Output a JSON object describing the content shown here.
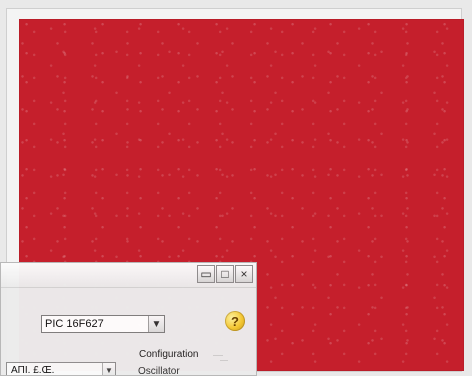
{
  "image_panel": {
    "background_color": "#c51f2c"
  },
  "dialog": {
    "title_buttons": {
      "minimize": "▭",
      "maximize": "□",
      "close": "×"
    },
    "device": {
      "value": "PIC 16F627",
      "arrow": "▼"
    },
    "help": {
      "icon": "?"
    },
    "configuration_label": "Configuration",
    "lower_field": {
      "text": "ΑΠΙ. £.Œ.",
      "arrow": "▼"
    },
    "lower_label": "Oscillator"
  }
}
